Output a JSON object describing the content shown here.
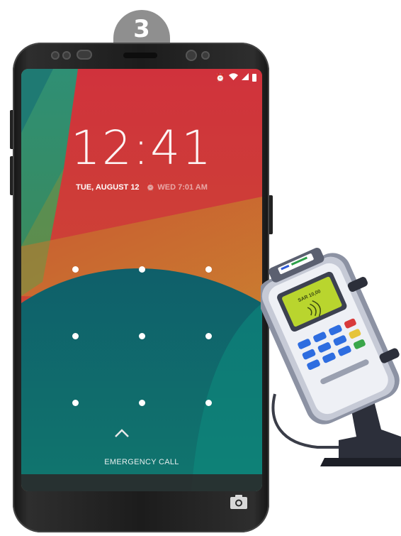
{
  "step": {
    "number": "3"
  },
  "status_bar": {
    "icons": [
      "alarm-icon",
      "wifi-icon",
      "signal-icon",
      "battery-icon"
    ]
  },
  "lock_screen": {
    "time": "12:41",
    "date": "TUE, AUGUST 12",
    "alarm": "WED 7:01 AM",
    "emergency_call": "EMERGENCY CALL",
    "pattern_grid": {
      "rows": 3,
      "cols": 3
    }
  },
  "colors": {
    "wallpaper_red": "#d23b2e",
    "wallpaper_orange": "#c9722e",
    "wallpaper_teal": "#0f6b6d",
    "wallpaper_green": "#3f8a6f",
    "badge_gray": "#8f8f8f"
  },
  "terminal": {
    "screen_text": "SAR 10,00"
  }
}
